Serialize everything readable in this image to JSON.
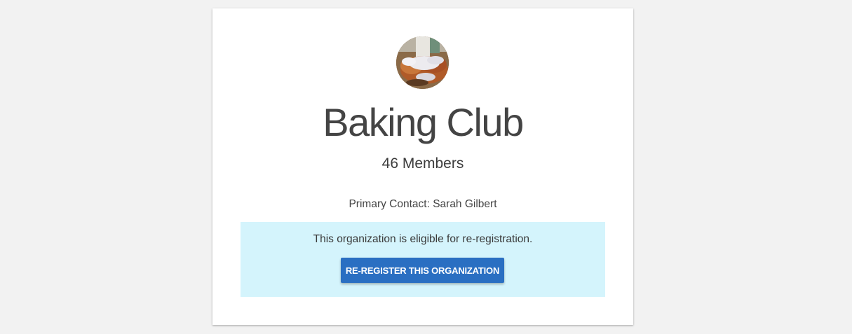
{
  "organization": {
    "name": "Baking Club",
    "members_label": "46 Members",
    "primary_contact_label": "Primary Contact: Sarah Gilbert",
    "avatar_icon": "baked-goods-photo"
  },
  "reregistration": {
    "message": "This organization is eligible for re-registration.",
    "button_label": "RE-REGISTER THIS ORGANIZATION"
  },
  "colors": {
    "page_background": "#f2f2f2",
    "card_background": "#ffffff",
    "notice_background": "#d4f4fc",
    "button_background": "#2a6fc2",
    "title_text": "#444444"
  }
}
